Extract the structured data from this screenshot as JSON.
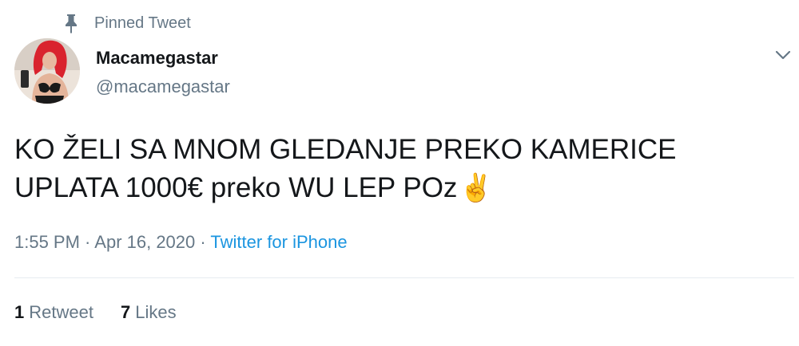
{
  "pinned": {
    "icon": "pin-icon",
    "label": "Pinned Tweet"
  },
  "user": {
    "name": "Macamegastar",
    "handle": "@macamegastar",
    "avatar": "avatar"
  },
  "menu": {
    "icon": "chevron-down-icon"
  },
  "tweet": {
    "line1": "KO ŽELI SA MNOM GLEDANJE PREKO KAMERICE",
    "line2": "UPLATA 1000€ preko WU LEP POz",
    "emoji": "✌️"
  },
  "meta": {
    "time": "1:55 PM",
    "separator1": " · ",
    "date": "Apr 16, 2020",
    "separator2": " · ",
    "source": "Twitter for iPhone"
  },
  "stats": {
    "retweets_count": "1",
    "retweets_label": "Retweet",
    "likes_count": "7",
    "likes_label": "Likes"
  },
  "colors": {
    "text_primary": "#14171a",
    "text_secondary": "#657786",
    "link": "#1b95e0",
    "divider": "#e6ecf0"
  }
}
